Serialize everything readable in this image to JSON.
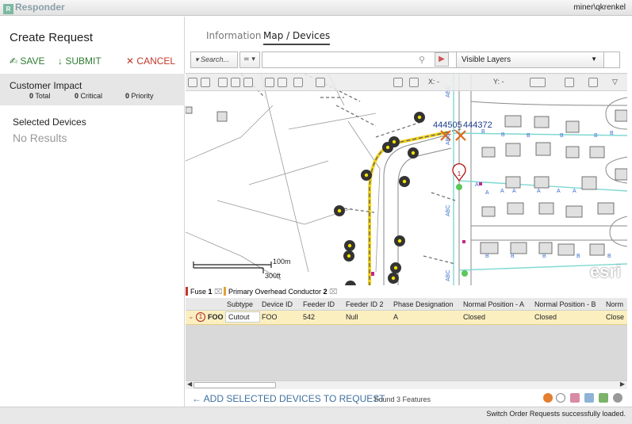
{
  "app": {
    "logo": "Responder",
    "user": "miner\\qkrenkel"
  },
  "left": {
    "title": "Create Request",
    "actions": {
      "save": "SAVE",
      "submit": "SUBMIT",
      "cancel": "CANCEL"
    },
    "impact": {
      "title": "Customer Impact",
      "total": "0",
      "total_label": "Total",
      "critical": "0",
      "critical_label": "Critical",
      "priority": "0",
      "priority_label": "Priority"
    },
    "selected": {
      "title": "Selected Devices",
      "empty": "No Results"
    }
  },
  "tabs": [
    {
      "label": "Information"
    },
    {
      "label": "Map / Devices"
    }
  ],
  "search": {
    "field": "Search...",
    "operator": "=",
    "value": ""
  },
  "layers": {
    "label": "Visible Layers"
  },
  "map": {
    "toolbar": {
      "x_label": "X: -",
      "y_label": "Y: -"
    },
    "device_labels": [
      "444505",
      "444372"
    ],
    "marker_number": "1",
    "scale": {
      "metric": "100m",
      "imperial": "300ft"
    },
    "attribution": "esri"
  },
  "grid": {
    "tabs": [
      {
        "label": "Fuse",
        "count": "1"
      },
      {
        "label": "Primary Overhead Conductor",
        "count": "2"
      }
    ],
    "columns": [
      "Subtype",
      "Device ID",
      "Feeder ID",
      "Feeder ID 2",
      "Phase Designation",
      "Normal Position - A",
      "Normal Position - B",
      "Norm"
    ],
    "rows": [
      {
        "index": "1",
        "name": "FOO",
        "subtype": "Cutout",
        "device_id": "FOO",
        "feeder_id": "542",
        "feeder_id2": "Null",
        "phase": "A",
        "pos_a": "Closed",
        "pos_b": "Closed",
        "pos_c": "Close"
      }
    ]
  },
  "footer": {
    "add": "ADD SELECTED DEVICES TO REQUEST",
    "found": "Found 3 Features"
  },
  "status": {
    "message": "Switch Order Requests successfully loaded."
  },
  "colors": {
    "accent_green": "#2f7d32",
    "cancel_red": "#c0392b",
    "row_highlight": "#fbefc0",
    "feeder_yellow": "#f2d21e",
    "conductor_cyan": "#7fd8d2"
  }
}
